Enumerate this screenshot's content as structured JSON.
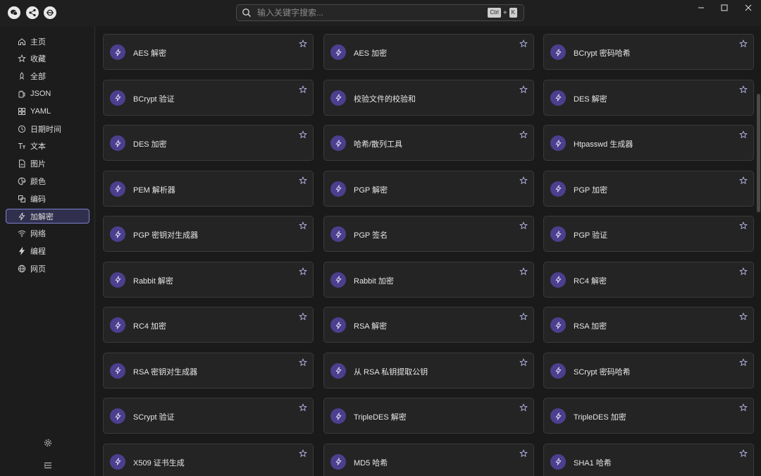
{
  "search": {
    "placeholder": "输入关键字搜索...",
    "shortcut_mod": "Ctrl",
    "shortcut_plus": "+",
    "shortcut_key": "K"
  },
  "sidebar": {
    "items": [
      {
        "label": "主页",
        "icon": "home-icon"
      },
      {
        "label": "收藏",
        "icon": "star-icon"
      },
      {
        "label": "全部",
        "icon": "rocket-icon"
      },
      {
        "label": "JSON",
        "icon": "json-icon"
      },
      {
        "label": "YAML",
        "icon": "grid-icon"
      },
      {
        "label": "日期时间",
        "icon": "clock-icon"
      },
      {
        "label": "文本",
        "icon": "text-icon"
      },
      {
        "label": "图片",
        "icon": "file-image-icon"
      },
      {
        "label": "颜色",
        "icon": "palette-icon"
      },
      {
        "label": "编码",
        "icon": "encode-icon"
      },
      {
        "label": "加解密",
        "icon": "bolt-icon",
        "active": true
      },
      {
        "label": "网络",
        "icon": "wifi-icon"
      },
      {
        "label": "编程",
        "icon": "code-icon"
      },
      {
        "label": "网页",
        "icon": "globe-icon"
      }
    ]
  },
  "tools": [
    "AES 解密",
    "AES 加密",
    "BCrypt 密码哈希",
    "BCrypt 验证",
    "校验文件的校验和",
    "DES 解密",
    "DES 加密",
    "哈希/散列工具",
    "Htpasswd 生成器",
    "PEM 解析器",
    "PGP 解密",
    "PGP 加密",
    "PGP 密钥对生成器",
    "PGP 签名",
    "PGP 验证",
    "Rabbit 解密",
    "Rabbit 加密",
    "RC4 解密",
    "RC4 加密",
    "RSA 解密",
    "RSA 加密",
    "RSA 密钥对生成器",
    "从 RSA 私钥提取公钥",
    "SCrypt 密码哈希",
    "SCrypt 验证",
    "TripleDES 解密",
    "TripleDES 加密",
    "X509 证书生成",
    "MD5 哈希",
    "SHA1 哈希"
  ],
  "colors": {
    "accent": "#4b3f8e",
    "active_border": "#7f7fd0"
  }
}
